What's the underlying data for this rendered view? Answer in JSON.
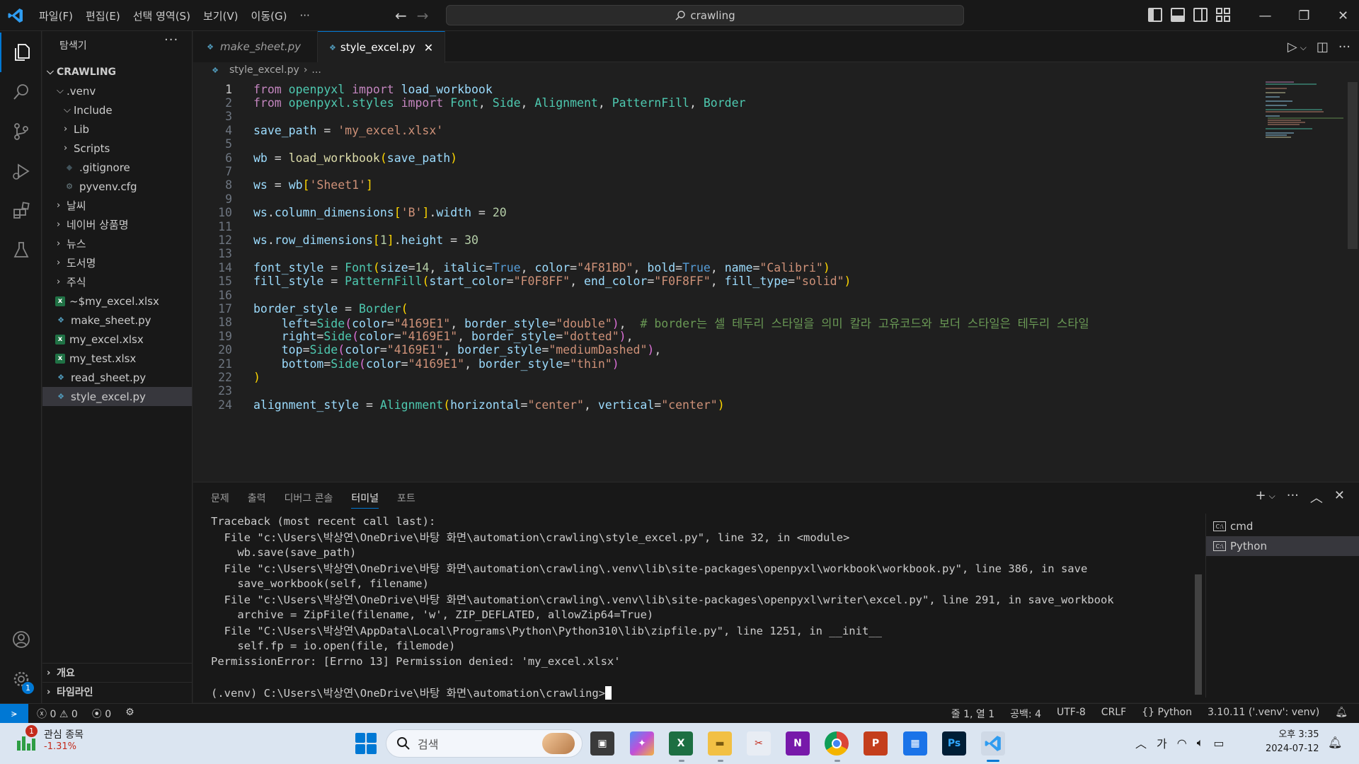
{
  "window": {
    "search_text": "crawling",
    "menu": [
      "파일(F)",
      "편집(E)",
      "선택 영역(S)",
      "보기(V)",
      "이동(G)",
      "···"
    ]
  },
  "sidebar": {
    "title": "탐색기",
    "more": "···",
    "root": "CRAWLING",
    "items": [
      {
        "label": ".venv",
        "type": "folder-open",
        "indent": 1
      },
      {
        "label": "Include",
        "type": "folder-open",
        "indent": 2
      },
      {
        "label": "Lib",
        "type": "folder",
        "indent": 2
      },
      {
        "label": "Scripts",
        "type": "folder",
        "indent": 2
      },
      {
        "label": ".gitignore",
        "type": "git",
        "indent": 2
      },
      {
        "label": "pyvenv.cfg",
        "type": "cfg",
        "indent": 2
      },
      {
        "label": "날씨",
        "type": "folder",
        "indent": 1
      },
      {
        "label": "네이버 상품명",
        "type": "folder",
        "indent": 1
      },
      {
        "label": "뉴스",
        "type": "folder",
        "indent": 1
      },
      {
        "label": "도서명",
        "type": "folder",
        "indent": 1
      },
      {
        "label": "주식",
        "type": "folder",
        "indent": 1
      },
      {
        "label": "~$my_excel.xlsx",
        "type": "xlsx",
        "indent": 1
      },
      {
        "label": "make_sheet.py",
        "type": "py",
        "indent": 1
      },
      {
        "label": "my_excel.xlsx",
        "type": "xlsx",
        "indent": 1
      },
      {
        "label": "my_test.xlsx",
        "type": "xlsx",
        "indent": 1
      },
      {
        "label": "read_sheet.py",
        "type": "py",
        "indent": 1
      },
      {
        "label": "style_excel.py",
        "type": "py",
        "indent": 1,
        "selected": true
      }
    ],
    "outline": "개요",
    "timeline": "타임라인"
  },
  "tabs": [
    {
      "label": "make_sheet.py",
      "active": false
    },
    {
      "label": "style_excel.py",
      "active": true
    }
  ],
  "breadcrumb": {
    "file": "style_excel.py",
    "rest": "..."
  },
  "editor": {
    "line_numbers": [
      "1",
      "2",
      "3",
      "4",
      "5",
      "6",
      "7",
      "8",
      "9",
      "10",
      "11",
      "12",
      "13",
      "14",
      "15",
      "16",
      "17",
      "18",
      "19",
      "20",
      "21",
      "22",
      "23",
      "24"
    ],
    "current_line": 1
  },
  "panel": {
    "tabs": [
      "문제",
      "출력",
      "디버그 콘솔",
      "터미널",
      "포트"
    ],
    "active_tab": "터미널",
    "terminal_lines": [
      "Traceback (most recent call last):",
      "  File \"c:\\Users\\박상연\\OneDrive\\바탕 화면\\automation\\crawling\\style_excel.py\", line 32, in <module>",
      "    wb.save(save_path)",
      "  File \"c:\\Users\\박상연\\OneDrive\\바탕 화면\\automation\\crawling\\.venv\\lib\\site-packages\\openpyxl\\workbook\\workbook.py\", line 386, in save",
      "    save_workbook(self, filename)",
      "  File \"c:\\Users\\박상연\\OneDrive\\바탕 화면\\automation\\crawling\\.venv\\lib\\site-packages\\openpyxl\\writer\\excel.py\", line 291, in save_workbook",
      "    archive = ZipFile(filename, 'w', ZIP_DEFLATED, allowZip64=True)",
      "  File \"C:\\Users\\박상연\\AppData\\Local\\Programs\\Python\\Python310\\lib\\zipfile.py\", line 1251, in __init__",
      "    self.fp = io.open(file, filemode)",
      "PermissionError: [Errno 13] Permission denied: 'my_excel.xlsx'",
      "",
      "(.venv) C:\\Users\\박상연\\OneDrive\\바탕 화면\\automation\\crawling>"
    ],
    "terminals": [
      "cmd",
      "Python"
    ],
    "selected_terminal": "Python"
  },
  "status": {
    "errors": "0",
    "warnings": "0",
    "ports": "0",
    "position": "줄 1, 열 1",
    "spaces": "공백: 4",
    "encoding": "UTF-8",
    "eol": "CRLF",
    "language": "Python",
    "interpreter": "3.10.11 ('.venv': venv)"
  },
  "taskbar": {
    "stock_title": "관심 종목",
    "stock_change": "-1.31%",
    "stock_badge": "1",
    "search_placeholder": "검색",
    "ime": "가",
    "time": "오후 3:35",
    "date": "2024-07-12"
  },
  "badges": {
    "settings": "1"
  },
  "colors": {
    "accent": "#0078d4",
    "background": "#1f1f1f"
  }
}
